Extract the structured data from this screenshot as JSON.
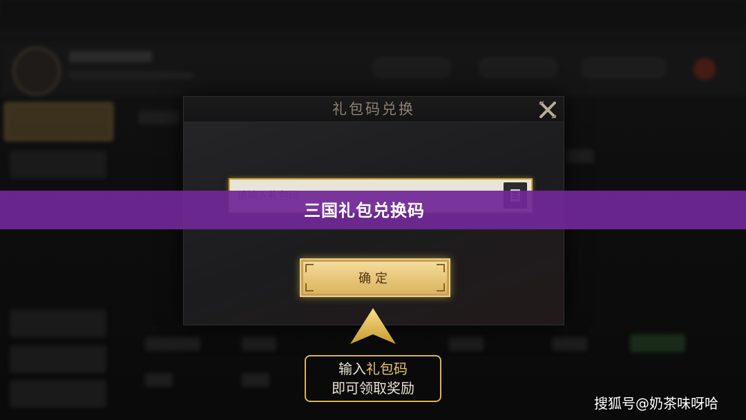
{
  "banner": {
    "title": "三国礼包兑换码"
  },
  "dialog": {
    "title": "礼包码兑换",
    "input_placeholder": "请输入礼包码",
    "confirm_label": "确定"
  },
  "hint": {
    "line1_prefix": "输入",
    "line1_accent": "礼包码",
    "line2": "即可领取奖励"
  },
  "watermark": "搜狐号@奶茶味呀哈",
  "colors": {
    "banner": "#7028a0",
    "gold_border": "#c9a638",
    "confirm_gold": "#e8c77a",
    "hint_accent": "#e9c46b"
  },
  "icons": [
    "close-icon",
    "paste-icon",
    "up-arrow-icon"
  ]
}
